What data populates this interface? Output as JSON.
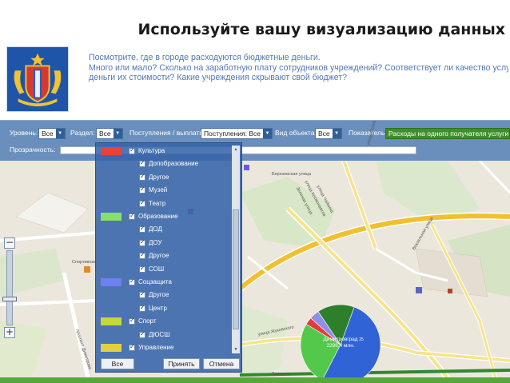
{
  "slide": {
    "title": "Используйте вашу визуализацию данных",
    "intro_line1": "Посмотрите, где в городе расходуются бюджетные деньги.",
    "intro_line2": "Много или мало? Сколько на заработную плату сотрудников учреждений? Соответствует ли качество услуг, та",
    "intro_line3": "деньги их стоимости? Какие учреждения скрывают свой бюджет?"
  },
  "toolbar": {
    "level_label": "Уровень:",
    "level_value": "Все",
    "section_label": "Раздел:",
    "section_value": "Все",
    "flow_label": "Поступления / выплаты:",
    "flow_value": "Поступления: Все",
    "object_label": "Вид объекта:",
    "object_value": "Все",
    "indicator_label": "Показатель:",
    "indicator_value": "Расходы на одного получателя услуги, ты",
    "opacity_label": "Прозрачность:"
  },
  "legend": {
    "items": [
      {
        "label": "Культура",
        "level": 0,
        "color": "#e8423a"
      },
      {
        "label": "Допобразование",
        "level": 1
      },
      {
        "label": "Другое",
        "level": 1
      },
      {
        "label": "Музей",
        "level": 1
      },
      {
        "label": "Театр",
        "level": 1
      },
      {
        "label": "Образование",
        "level": 0,
        "color": "#86e06a"
      },
      {
        "label": "ДОД",
        "level": 1
      },
      {
        "label": "ДОУ",
        "level": 1
      },
      {
        "label": "Другое",
        "level": 1
      },
      {
        "label": "СОШ",
        "level": 1
      },
      {
        "label": "Соцзащита",
        "level": 0,
        "color": "#6f7ff0"
      },
      {
        "label": "Другое",
        "level": 1
      },
      {
        "label": "Центр",
        "level": 1
      },
      {
        "label": "Спорт",
        "level": 0,
        "color": "#c6d63a"
      },
      {
        "label": "ДЮСШ",
        "level": 1
      },
      {
        "label": "Управление",
        "level": 0,
        "color": "#e2d042"
      }
    ],
    "btn_all": "Все",
    "btn_apply": "Принять",
    "btn_cancel": "Отмена"
  },
  "map": {
    "pie_label_city": "Димитровград",
    "pie_label_value": "2299,4 млн.",
    "pie_badge": "25",
    "streets": {
      "berezovskaya": "Березовская улица",
      "chaykina": "улица Чайкина",
      "kosmonavtov": "улица Космонавтов",
      "zelenaya": "Зеленая улица",
      "osipenko": "улица Осипенко",
      "vokzalnaya": "Вокзальная улица",
      "zhukovskogo": "улица Жуковского",
      "dimitrova": "проспект Димитрова",
      "sportivnaya": "Спортивная",
      "zapadnaya": "Западная",
      "zhanna": "Zhanna",
      "zapretka": "Запретка"
    },
    "pie_slices": [
      {
        "name": "blue",
        "value": 52,
        "color": "#2f63d6"
      },
      {
        "name": "green-light",
        "value": 26,
        "color": "#54c84a"
      },
      {
        "name": "red",
        "value": 3,
        "color": "#e33a3a"
      },
      {
        "name": "violet",
        "value": 4,
        "color": "#8f8fe8"
      },
      {
        "name": "green-dark",
        "value": 15,
        "color": "#2e7f2a"
      }
    ]
  }
}
